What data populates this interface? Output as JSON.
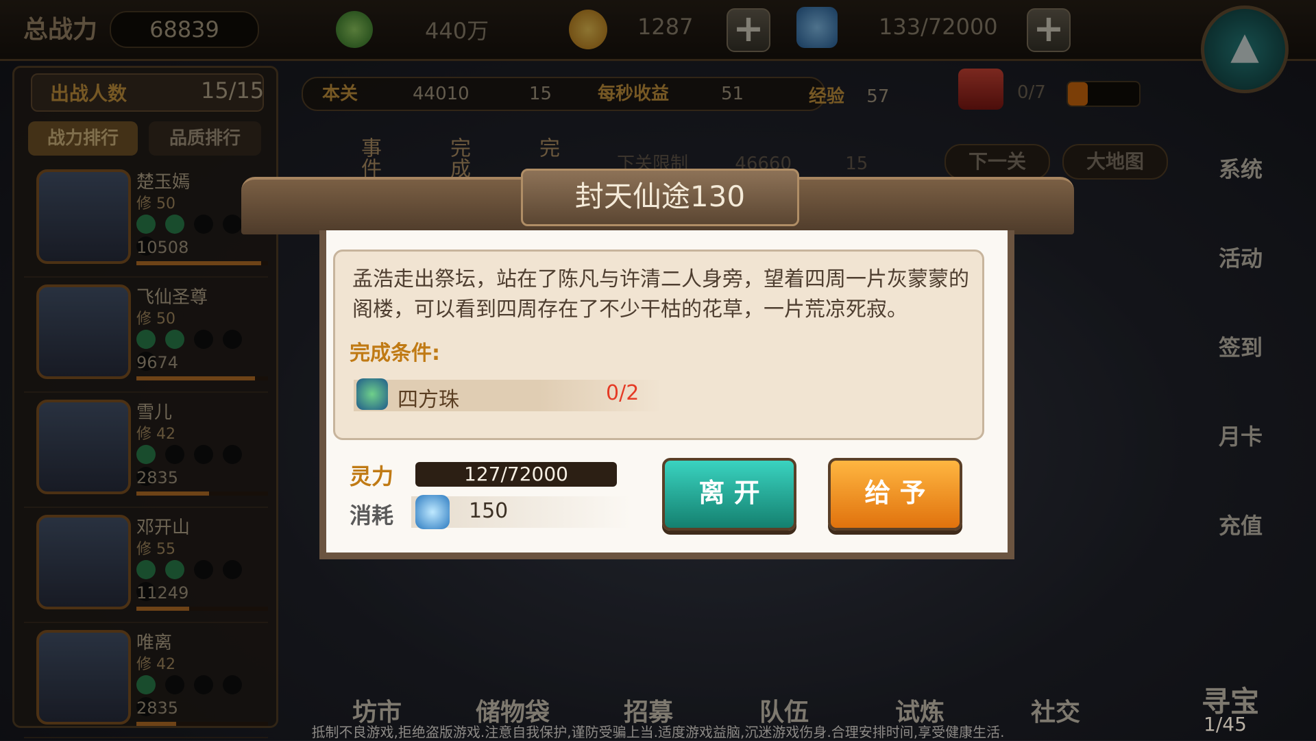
{
  "top": {
    "power_label": "总战力",
    "power_value": "68839",
    "jade": "440万",
    "gold": "1287",
    "spirit": "133/72000"
  },
  "left": {
    "deploy_label": "出战人数",
    "deploy_value": "15/15",
    "tab_power": "战力排行",
    "tab_quality": "品质排行",
    "heroes": [
      {
        "name": "楚玉嫣",
        "level": "修 50",
        "power": "10508",
        "dots": 2,
        "bar": 0.95
      },
      {
        "name": "飞仙圣尊",
        "level": "修 50",
        "power": "9674",
        "dots": 2,
        "bar": 0.9
      },
      {
        "name": "雪儿",
        "level": "修 42",
        "power": "2835",
        "dots": 1,
        "bar": 0.55
      },
      {
        "name": "邓开山",
        "level": "修 55",
        "power": "11249",
        "dots": 2,
        "bar": 0.4
      },
      {
        "name": "唯离",
        "level": "修 42",
        "power": "2835",
        "dots": 1,
        "bar": 0.3
      }
    ]
  },
  "stage": {
    "this_label": "本关",
    "this_power": "44010",
    "this_count": "15",
    "income_label": "每秒收益",
    "income_value": "51",
    "exp_label": "经验",
    "exp_value": "57",
    "chest_progress": "0/7",
    "next_limit_label": "下关限制",
    "next_power": "46660",
    "next_count": "15",
    "next_button": "下一关",
    "map_button": "大地图",
    "event_tabs": [
      "事件",
      "完成",
      "完"
    ]
  },
  "right_menu": [
    "系统",
    "活动",
    "签到",
    "月卡",
    "充值"
  ],
  "bottom_menu": [
    "坊市",
    "储物袋",
    "招募",
    "队伍",
    "试炼",
    "社交"
  ],
  "treasure": "寻宝",
  "pager": "1/45",
  "notice": "抵制不良游戏,拒绝盗版游戏.注意自我保护,谨防受骗上当.适度游戏益脑,沉迷游戏伤身.合理安排时间,享受健康生活.",
  "dialog": {
    "title": "封天仙途130",
    "story": "孟浩走出祭坛，站在了陈凡与许清二人身旁，望着四周一片灰蒙蒙的阁楼，可以看到四周存在了不少干枯的花草，一片荒凉死寂。",
    "condition_label": "完成条件:",
    "condition_item": "四方珠",
    "condition_count": "0/2",
    "lingli_label": "灵力",
    "lingli_value": "127/72000",
    "cost_label": "消耗",
    "cost_value": "150",
    "leave_button": "离 开",
    "give_button": "给 予"
  },
  "colors": {
    "accent_gold": "#c07a14",
    "teal_button": "#1fa995",
    "orange_button": "#f29422",
    "count_red": "#e53a25"
  }
}
